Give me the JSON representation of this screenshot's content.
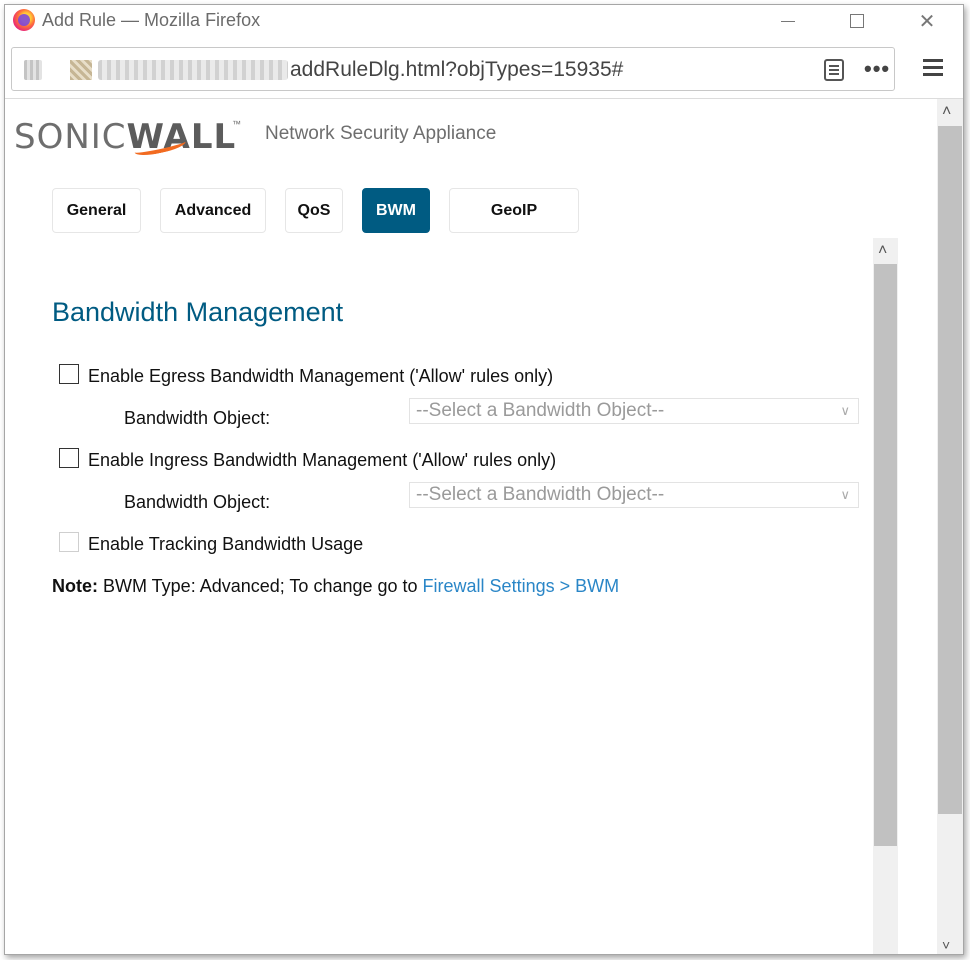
{
  "window": {
    "title": "Add Rule — Mozilla Firefox",
    "close_glyph": "✕"
  },
  "navbar": {
    "url_visible": "addRuleDlg.html?objTypes=15935#",
    "more_glyph": "•••"
  },
  "scroll": {
    "up_glyph": "˄",
    "down_glyph": "˅"
  },
  "header": {
    "brand_sonic": "SONIC",
    "brand_wall": "WALL",
    "brand_tm": "™",
    "subtitle": "Network Security Appliance"
  },
  "tabs": [
    {
      "label": "General"
    },
    {
      "label": "Advanced"
    },
    {
      "label": "QoS"
    },
    {
      "label": "BWM",
      "active": true
    },
    {
      "label": "GeoIP"
    }
  ],
  "section": {
    "title": "Bandwidth Management",
    "egress_label": "Enable Egress Bandwidth Management ('Allow' rules only)",
    "egress_object_label": "Bandwidth Object:",
    "egress_select_value": "--Select a Bandwidth Object--",
    "ingress_label": "Enable Ingress Bandwidth Management ('Allow' rules only)",
    "ingress_object_label": "Bandwidth Object:",
    "ingress_select_value": "--Select a Bandwidth Object--",
    "tracking_label": "Enable Tracking Bandwidth Usage",
    "chevron_glyph": "∨"
  },
  "note": {
    "prefix": "Note:",
    "text": " BWM Type: Advanced; To change go to ",
    "link": "Firewall Settings > BWM"
  },
  "colors": {
    "accent": "#005b82",
    "link": "#2a86c7",
    "logo_orange": "#f26b21"
  }
}
